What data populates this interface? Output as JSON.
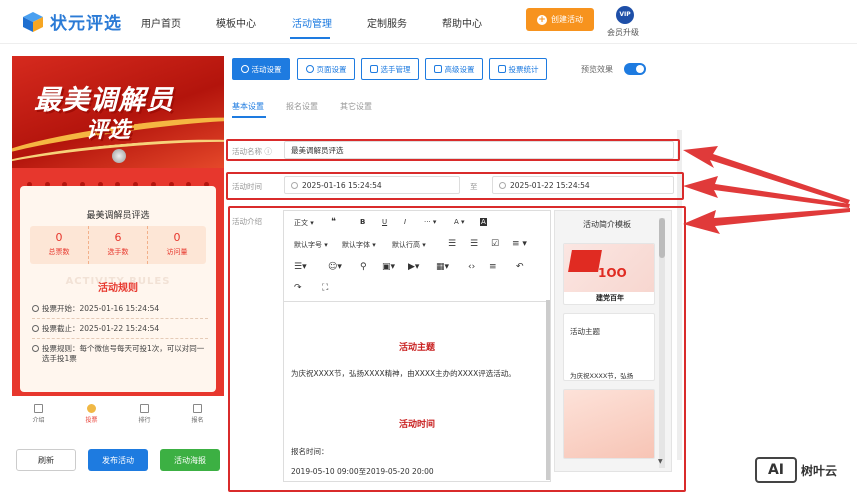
{
  "brand": {
    "name": "状元评选"
  },
  "nav": {
    "items": [
      "用户首页",
      "模板中心",
      "活动管理",
      "定制服务",
      "帮助中心"
    ],
    "create_button": "创建活动",
    "vip_badge": "VIP",
    "vip_label": "会员升级"
  },
  "preview": {
    "banner_line1": "最美调解员",
    "banner_line2": "评选",
    "card_title": "最美调解员评选",
    "stats": [
      {
        "value": "0",
        "label": "总票数"
      },
      {
        "value": "6",
        "label": "选手数"
      },
      {
        "value": "0",
        "label": "访问量"
      }
    ],
    "rules_watermark": "ACTIVITY RULES",
    "rules_title": "活动规则",
    "rule_start": "投票开始：2025-01-16 15:24:54",
    "rule_end": "投票截止：2025-01-22 15:24:54",
    "rule_text_1": "投票规则：每个微信号每天可投1次，可以对同一",
    "rule_text_2": "选手投1票",
    "tabs": [
      "介绍",
      "投票",
      "排行",
      "报名"
    ]
  },
  "bottom_buttons": {
    "refresh": "刷新",
    "publish": "发布活动",
    "poster": "活动海报"
  },
  "settings_buttons": [
    "活动设置",
    "页面设置",
    "选手管理",
    "高级设置",
    "投票统计"
  ],
  "preview_toggle_label": "预览效果",
  "subtabs": [
    "基本设置",
    "报名设置",
    "其它设置"
  ],
  "form": {
    "name_label": "活动名称",
    "name_value": "最美调解员评选",
    "time_label": "活动时间",
    "start_time": "2025-01-16 15:24:54",
    "to_label": "至",
    "end_time": "2025-01-22 15:24:54",
    "intro_label": "活动介绍"
  },
  "editor": {
    "toolbar_row1": [
      "正文",
      "❝",
      "B",
      "U",
      "I",
      "···",
      "A",
      "A"
    ],
    "toolbar_row2": [
      "默认字号",
      "默认字体",
      "默认行高",
      "☰",
      "☰",
      "☑",
      "≡"
    ],
    "heading1": "活动主题",
    "para1": "为庆祝XXXX节，弘扬XXXX精神，由XXXX主办的XXXX评选活动。",
    "heading2": "活动时间",
    "para2": "报名时间：",
    "para3": "2019-05-10 09:00至2019-05-20 20:00"
  },
  "template_panel": {
    "title": "活动简介模板",
    "card1_caption": "建党百年",
    "card2_title": "活动主题",
    "card2_text": "为庆祝XXXX节，弘扬"
  },
  "watermark": {
    "ai": "AI",
    "text": "树叶云"
  },
  "colors": {
    "primary": "#1e7be0",
    "orange": "#f7931e",
    "green": "#3cb043",
    "red": "#e7372d",
    "highlight": "#d92b2b"
  }
}
